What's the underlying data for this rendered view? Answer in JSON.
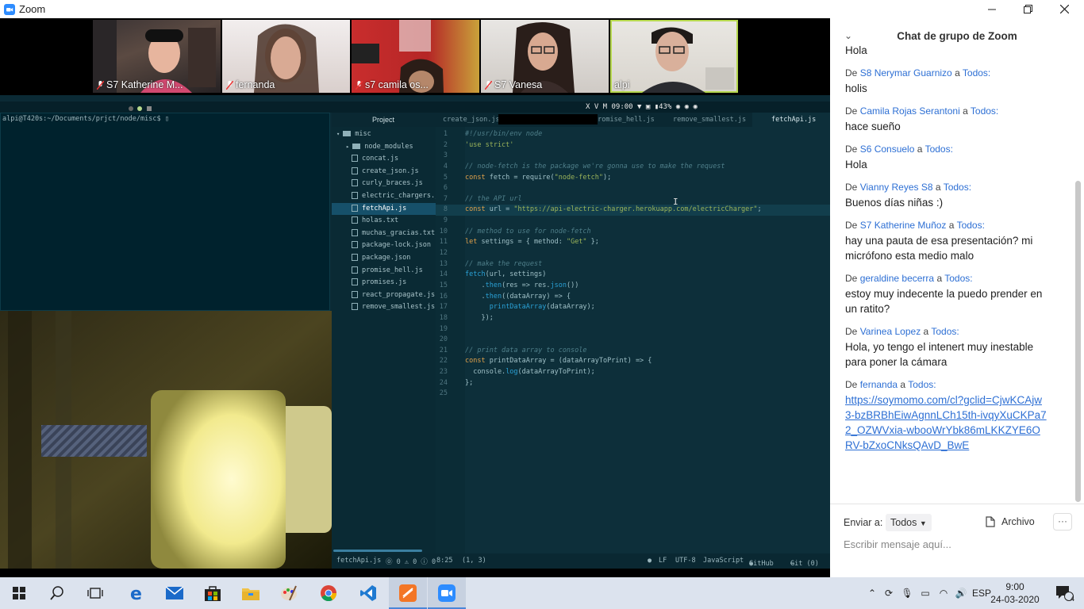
{
  "window": {
    "title": "Zoom"
  },
  "participants": [
    {
      "name": "S7 Katherine M...",
      "muted": true
    },
    {
      "name": "fernanda",
      "muted": true
    },
    {
      "name": "s7 camila os...",
      "muted": true
    },
    {
      "name": "S7 Vanesa",
      "muted": true
    },
    {
      "name": "alpi",
      "muted": false
    }
  ],
  "shared_screen": {
    "sys_status": "X V M 09:00 ▼ ▣ ▮43% ◉ ◉ ◉",
    "terminal_prompt": "alpi@T420s:~/Documents/prjct/node/misc$ ▯",
    "editor": {
      "project_label": "Project",
      "tabs": [
        "create_json.js",
        "promise_hell.js",
        "remove_smallest.js",
        "fetchApi.js"
      ],
      "active_tab": "fetchApi.js",
      "tree": {
        "root": "misc",
        "items": [
          "node_modules",
          "concat.js",
          "create_json.js",
          "curly_braces.js",
          "electric_chargers.js",
          "fetchApi.js",
          "holas.txt",
          "muchas_gracias.txt",
          "package-lock.json",
          "package.json",
          "promise_hell.js",
          "promises.js",
          "react_propagate.js",
          "remove_smallest.js"
        ],
        "selected": "fetchApi.js"
      },
      "line_numbers": [
        "1",
        "2",
        "3",
        "4",
        "5",
        "6",
        "7",
        "8",
        "9",
        "10",
        "11",
        "12",
        "13",
        "14",
        "15",
        "16",
        "17",
        "18",
        "19",
        "20",
        "21",
        "22",
        "23",
        "24",
        "25"
      ],
      "code": {
        "l1": "#!/usr/bin/env node",
        "l2": "'use strict'",
        "l4": "// node-fetch is the package we're gonna use to make the request",
        "l5a": "const",
        "l5b": " fetch = require(",
        "l5c": "\"node-fetch\"",
        "l5d": ");",
        "l7": "// the API url",
        "l8a": "const",
        "l8b": " url = ",
        "l8c": "\"https://api-electric-charger.herokuapp.com/electricCharger\"",
        "l8d": ";",
        "l10": "// method to use for node-fetch",
        "l11a": "let",
        "l11b": " settings = { method: ",
        "l11c": "\"Get\"",
        "l11d": " };",
        "l13": "// make the request",
        "l14a": "fetch",
        "l14b": "(url, settings)",
        "l15a": "    .",
        "l15b": "then",
        "l15c": "(res => res.",
        "l15d": "json",
        "l15e": "())",
        "l16a": "    .",
        "l16b": "then",
        "l16c": "((dataArray) => {",
        "l17a": "      ",
        "l17b": "printDataArray",
        "l17c": "(dataArray);",
        "l18": "    });",
        "l21": "// print data array to console",
        "l22a": "const",
        "l22b": " printDataArray = (dataArrayToPrint) => {",
        "l23a": "  console.",
        "l23b": "log",
        "l23c": "(dataArrayToPrint);",
        "l24": "};"
      },
      "status": {
        "file": "fetchApi.js",
        "diagnostics": "⓪ 0 ⚠ 0 ⓘ 0",
        "position": "8:25",
        "selection": "(1, 3)",
        "eol": "LF",
        "encoding": "UTF-8",
        "grammar": "JavaScript",
        "github": "GitHub",
        "git": "Git (0)"
      }
    }
  },
  "chat": {
    "title": "Chat de grupo de Zoom",
    "partial_top": "Hola",
    "messages": [
      {
        "prefix": "De",
        "sender": "S8 Nerymar Guarnizo",
        "mid": "a",
        "to": "Todos:",
        "text": "holis"
      },
      {
        "prefix": "De",
        "sender": "Camila Rojas Serantoni",
        "mid": "a",
        "to": "Todos:",
        "text": "hace sueño"
      },
      {
        "prefix": "De",
        "sender": "S6 Consuelo",
        "mid": "a",
        "to": "Todos:",
        "text": "Hola"
      },
      {
        "prefix": "De",
        "sender": "Vianny Reyes S8",
        "mid": "a",
        "to": "Todos:",
        "text": "Buenos días niñas :)"
      },
      {
        "prefix": "De",
        "sender": "S7 Katherine Muñoz",
        "mid": "a",
        "to": "Todos:",
        "text": "hay una pauta de esa presentación? mi micrófono esta medio malo"
      },
      {
        "prefix": "De",
        "sender": "geraldine becerra",
        "mid": "a",
        "to": "Todos:",
        "text": "estoy muy indecente la puedo prender en un ratito?"
      },
      {
        "prefix": "De",
        "sender": "Varinea Lopez",
        "mid": "a",
        "to": "Todos:",
        "text": "Hola, yo tengo el intenert muy inestable para poner la cámara"
      },
      {
        "prefix": "De",
        "sender": "fernanda",
        "mid": "a",
        "to": "Todos:",
        "link": "https://soymomo.com/cl?gclid=CjwKCAjw3-bzBRBhEiwAgnnLCh15th-ivqyXuCKPa72_OZWVxia-wbooWrYbk86mLKKZYE6ORV-bZxoCNksQAvD_BwE"
      }
    ],
    "compose": {
      "send_to_label": "Enviar a:",
      "send_to_value": "Todos",
      "file_label": "Archivo",
      "more_label": "···",
      "placeholder": "Escribir mensaje aquí..."
    }
  },
  "taskbar": {
    "apps": [
      "start",
      "search",
      "task-view",
      "edge",
      "mail",
      "store",
      "explorer",
      "paint",
      "chrome",
      "vscode",
      "sublime",
      "zoom"
    ],
    "active": [
      "sublime",
      "zoom"
    ],
    "lang": "ESP",
    "time": "9:00",
    "date": "24-03-2020",
    "notifications": "4"
  },
  "colors": {
    "accent": "#2d8cff",
    "link": "#2d6fd4",
    "editor_bg": "#0d2f3a"
  }
}
